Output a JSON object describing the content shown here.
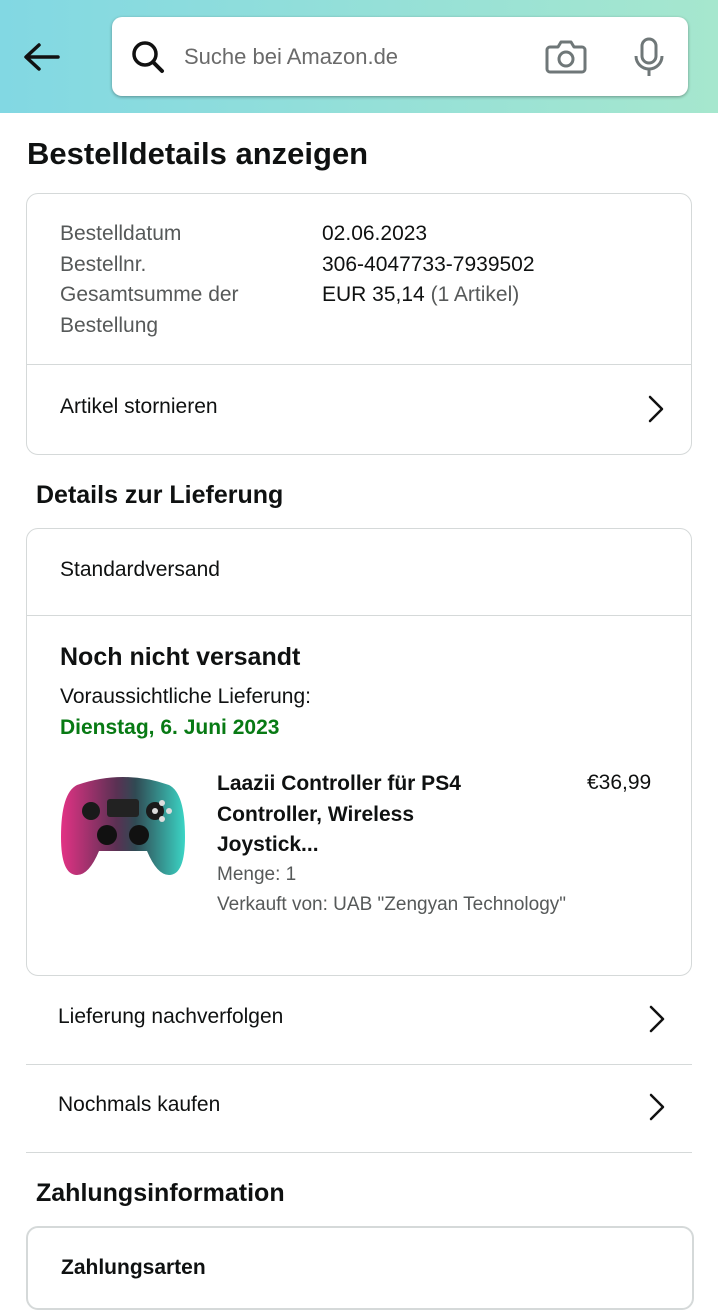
{
  "search": {
    "placeholder": "Suche bei Amazon.de"
  },
  "icons": {
    "back": "arrow-left-icon",
    "search": "search-icon",
    "camera": "camera-icon",
    "mic": "microphone-icon",
    "chevron": "chevron-right-icon"
  },
  "page": {
    "title": "Bestelldetails anzeigen"
  },
  "order_summary": {
    "date_label": "Bestelldatum",
    "date_value": "02.06.2023",
    "number_label": "Bestellnr.",
    "number_value": "306-4047733-7939502",
    "total_label_line1": "Gesamtsumme der",
    "total_label_line2": "Bestellung",
    "total_value": "EUR 35,14",
    "total_items": "(1 Artikel)",
    "cancel_label": "Artikel stornieren"
  },
  "delivery": {
    "heading": "Details zur Lieferung",
    "method": "Standardversand",
    "status": "Noch nicht versandt",
    "expected_label": "Voraussichtliche Lieferung:",
    "expected_date": "Dienstag, 6. Juni 2023",
    "item": {
      "title_line1": "Laazii Controller für PS4",
      "title_line2": "Controller, Wireless",
      "title_line3": "Joystick...",
      "price": "€36,99",
      "quantity": "Menge: 1",
      "seller": "Verkauft von: UAB \"Zengyan Technology\""
    },
    "track_label": "Lieferung nachverfolgen",
    "buy_again_label": "Nochmals kaufen"
  },
  "payment": {
    "heading": "Zahlungsinformation",
    "methods_label": "Zahlungsarten"
  },
  "colors": {
    "accent_green": "#087a14",
    "header_start": "#82d8e3",
    "header_end": "#a6e7ce"
  }
}
